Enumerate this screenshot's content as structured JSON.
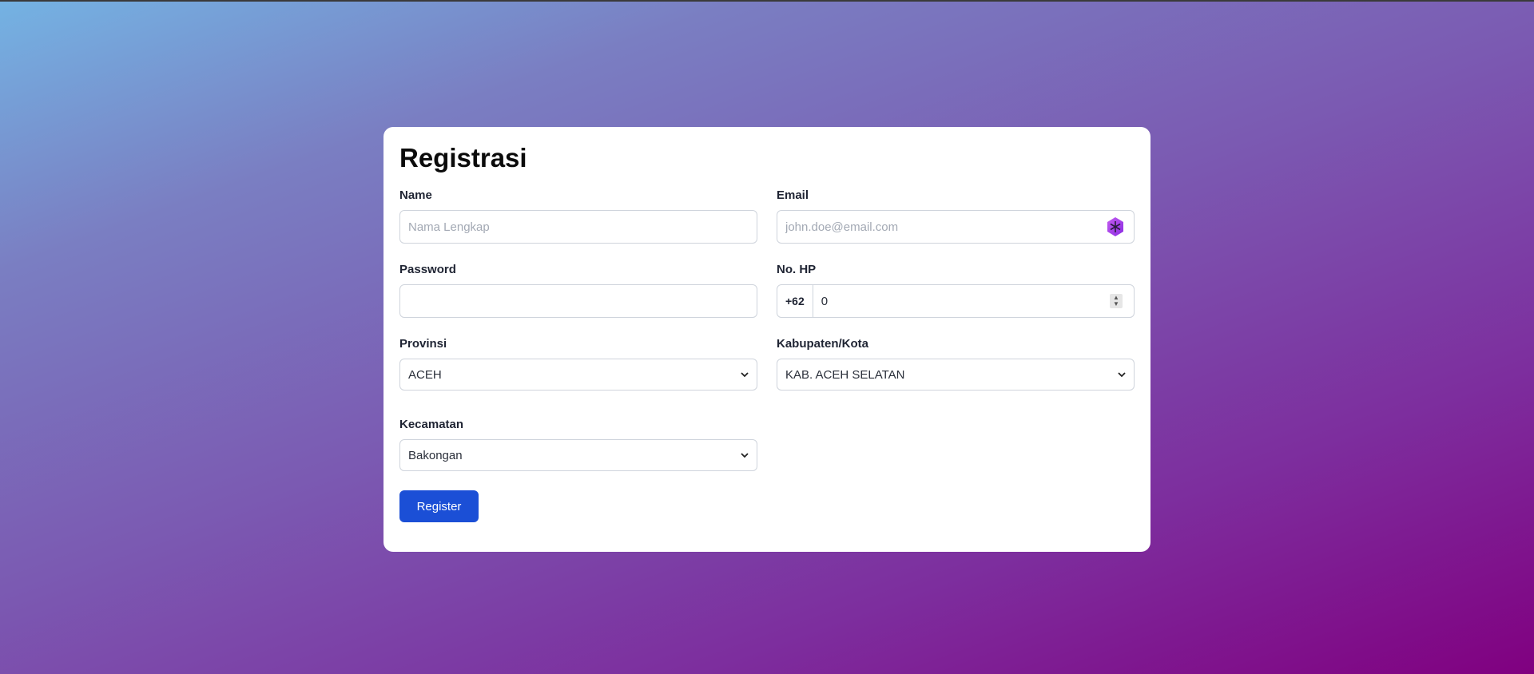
{
  "form": {
    "title": "Registrasi",
    "name": {
      "label": "Name",
      "placeholder": "Nama Lengkap",
      "value": ""
    },
    "email": {
      "label": "Email",
      "placeholder": "john.doe@email.com",
      "value": "",
      "extension_icon": "password-manager-icon"
    },
    "password": {
      "label": "Password",
      "value": ""
    },
    "phone": {
      "label": "No. HP",
      "prefix": "+62",
      "value": "0"
    },
    "province": {
      "label": "Provinsi",
      "selected": "ACEH"
    },
    "city": {
      "label": "Kabupaten/Kota",
      "selected": "KAB. ACEH SELATAN"
    },
    "district": {
      "label": "Kecamatan",
      "selected": "Bakongan"
    },
    "submit_label": "Register"
  },
  "colors": {
    "button": "#1b4fd6",
    "card": "#ffffff",
    "gradient_start": "#74b3e3",
    "gradient_end": "#800080"
  }
}
